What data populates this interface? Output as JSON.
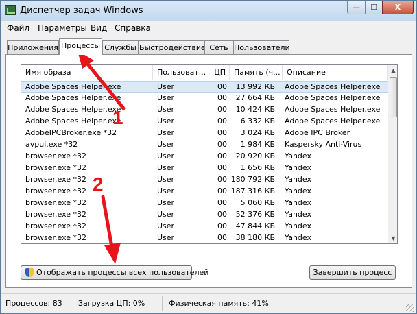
{
  "window": {
    "title": "Диспетчер задач Windows",
    "min_glyph": "—",
    "max_glyph": "☐",
    "close_glyph": "X"
  },
  "menu": [
    "Файл",
    "Параметры",
    "Вид",
    "Справка"
  ],
  "tabs": [
    {
      "label": "Приложения",
      "active": false
    },
    {
      "label": "Процессы",
      "active": true
    },
    {
      "label": "Службы",
      "active": false
    },
    {
      "label": "Быстродействие",
      "active": false
    },
    {
      "label": "Сеть",
      "active": false
    },
    {
      "label": "Пользователи",
      "active": false
    }
  ],
  "columns": {
    "name": "Имя образа",
    "user": "Пользоват...",
    "cpu": "ЦП",
    "memory": "Память (ч...",
    "description": "Описание"
  },
  "processes": [
    {
      "name": "Adobe Spaces Helper.exe",
      "user": "User",
      "cpu": "00",
      "memory": "13 992 КБ",
      "description": "Adobe Spaces Helper.exe",
      "selected": true
    },
    {
      "name": "Adobe Spaces Helper.exe",
      "user": "User",
      "cpu": "00",
      "memory": "27 664 КБ",
      "description": "Adobe Spaces Helper.exe",
      "selected": false
    },
    {
      "name": "Adobe Spaces Helper.exe",
      "user": "User",
      "cpu": "00",
      "memory": "10 424 КБ",
      "description": "Adobe Spaces Helper.exe",
      "selected": false
    },
    {
      "name": "Adobe Spaces Helper.exe",
      "user": "User",
      "cpu": "00",
      "memory": "6 332 КБ",
      "description": "Adobe Spaces Helper.exe",
      "selected": false
    },
    {
      "name": "AdobeIPCBroker.exe *32",
      "user": "User",
      "cpu": "00",
      "memory": "3 024 КБ",
      "description": "Adobe IPC Broker",
      "selected": false
    },
    {
      "name": "avpui.exe *32",
      "user": "User",
      "cpu": "00",
      "memory": "1 984 КБ",
      "description": "Kaspersky Anti-Virus",
      "selected": false
    },
    {
      "name": "browser.exe *32",
      "user": "User",
      "cpu": "00",
      "memory": "20 920 КБ",
      "description": "Yandex",
      "selected": false
    },
    {
      "name": "browser.exe *32",
      "user": "User",
      "cpu": "00",
      "memory": "1 656 КБ",
      "description": "Yandex",
      "selected": false
    },
    {
      "name": "browser.exe *32",
      "user": "User",
      "cpu": "00",
      "memory": "180 792 КБ",
      "description": "Yandex",
      "selected": false
    },
    {
      "name": "browser.exe *32",
      "user": "User",
      "cpu": "00",
      "memory": "187 316 КБ",
      "description": "Yandex",
      "selected": false
    },
    {
      "name": "browser.exe *32",
      "user": "User",
      "cpu": "00",
      "memory": "5 060 КБ",
      "description": "Yandex",
      "selected": false
    },
    {
      "name": "browser.exe *32",
      "user": "User",
      "cpu": "00",
      "memory": "52 376 КБ",
      "description": "Yandex",
      "selected": false
    },
    {
      "name": "browser.exe *32",
      "user": "User",
      "cpu": "00",
      "memory": "47 844 КБ",
      "description": "Yandex",
      "selected": false
    },
    {
      "name": "browser.exe *32",
      "user": "User",
      "cpu": "00",
      "memory": "38 180 КБ",
      "description": "Yandex",
      "selected": false
    }
  ],
  "scrollbar": {
    "up_glyph": "▲",
    "down_glyph": "▼"
  },
  "buttons": {
    "show_all": "Отображать процессы всех пользователей",
    "end_process": "Завершить процесс"
  },
  "status": {
    "processes": "Процессов: 83",
    "cpu": "Загрузка ЦП: 0%",
    "memory": "Физическая память: 41%"
  },
  "annotations": [
    {
      "label": "1",
      "color": "#e8131b"
    },
    {
      "label": "2",
      "color": "#e8131b"
    }
  ]
}
